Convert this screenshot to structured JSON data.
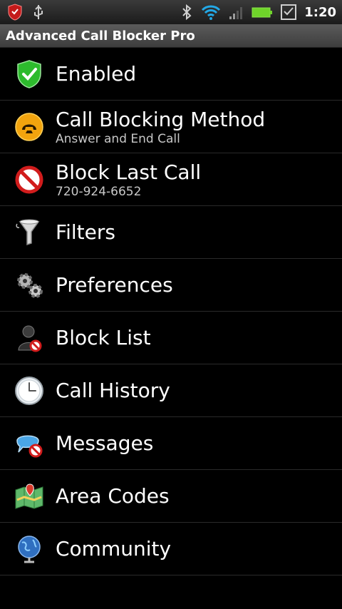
{
  "status_bar": {
    "time": "1:20"
  },
  "app": {
    "title": "Advanced Call Blocker Pro"
  },
  "menu": {
    "items": [
      {
        "label": "Enabled",
        "sub": ""
      },
      {
        "label": "Call Blocking Method",
        "sub": "Answer and End Call"
      },
      {
        "label": "Block Last Call",
        "sub": "720-924-6652"
      },
      {
        "label": "Filters",
        "sub": ""
      },
      {
        "label": "Preferences",
        "sub": ""
      },
      {
        "label": "Block List",
        "sub": ""
      },
      {
        "label": "Call History",
        "sub": ""
      },
      {
        "label": "Messages",
        "sub": ""
      },
      {
        "label": "Area Codes",
        "sub": ""
      },
      {
        "label": "Community",
        "sub": ""
      }
    ]
  },
  "colors": {
    "background": "#000000",
    "title_bar": "#4a4a4a",
    "accent_green": "#2dbb2d",
    "battery_green": "#6fd42a"
  }
}
